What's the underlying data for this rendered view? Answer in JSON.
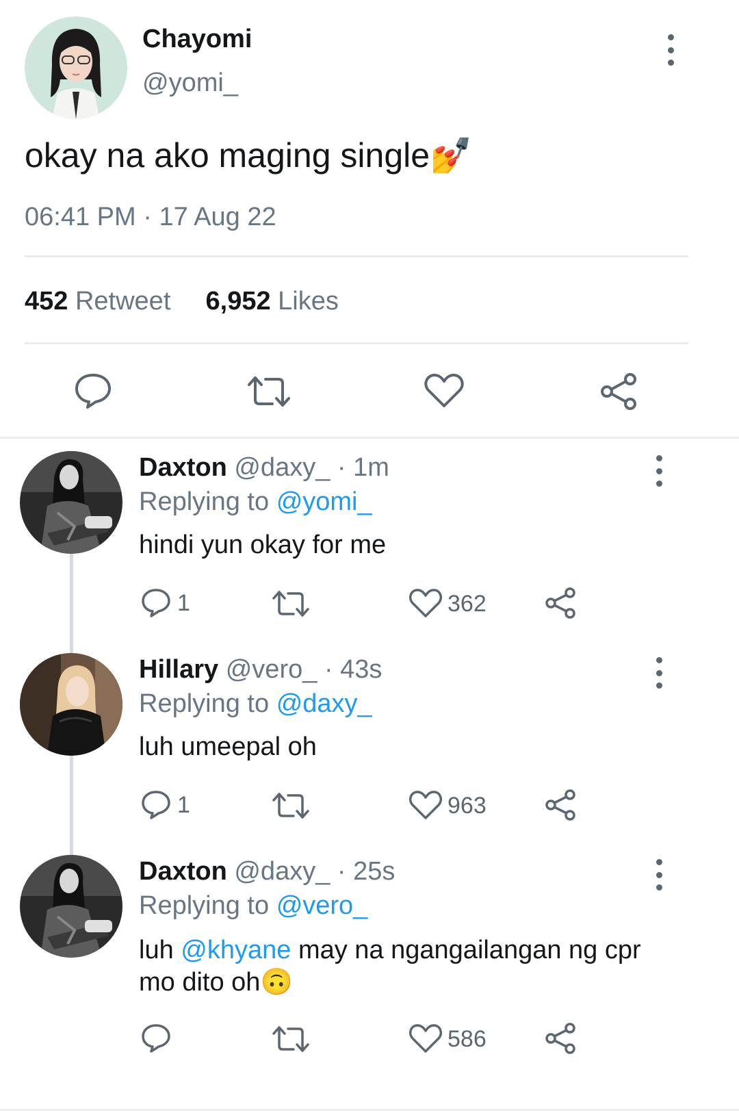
{
  "tweet": {
    "author_name": "Chayomi",
    "author_handle": "@yomi_",
    "text": "okay na ako maging single",
    "emoji": "💅",
    "time": "06:41 PM",
    "separator": "·",
    "date": "17 Aug 22",
    "retweets_count": "452",
    "retweets_label": "Retweet",
    "likes_count": "6,952",
    "likes_label": "Likes",
    "avatar_icon": "avatar-photo",
    "menu_icon": "more-vertical-icon",
    "actions": [
      "reply-icon",
      "retweet-icon",
      "like-icon",
      "share-icon"
    ]
  },
  "replies": [
    {
      "name": "Daxton",
      "handle": "@daxy_",
      "time": "· 1m",
      "replying_label": "Replying to",
      "replying_to": "@yomi_",
      "text": "hindi yun okay for me",
      "reply_count": "1",
      "like_count": "362"
    },
    {
      "name": "Hillary",
      "handle": "@vero_",
      "time": "· 43s",
      "replying_label": "Replying to",
      "replying_to": "@daxy_",
      "text": "luh umeepal oh",
      "reply_count": "1",
      "like_count": "963"
    },
    {
      "name": "Daxton",
      "handle": "@daxy_",
      "time": "· 25s",
      "replying_label": "Replying to",
      "replying_to": "@vero_",
      "text_before": "luh ",
      "mention": "@khyane",
      "text_after": " may na ngangailangan ng cpr",
      "text_line2": "mo dito oh",
      "emoji": "🙃",
      "reply_count": "",
      "like_count": "586"
    }
  ],
  "colors": {
    "text": "#14171a",
    "muted": "#687684",
    "link": "#1d9bf0",
    "icon": "#5b6670",
    "divider": "#e8ecef"
  }
}
